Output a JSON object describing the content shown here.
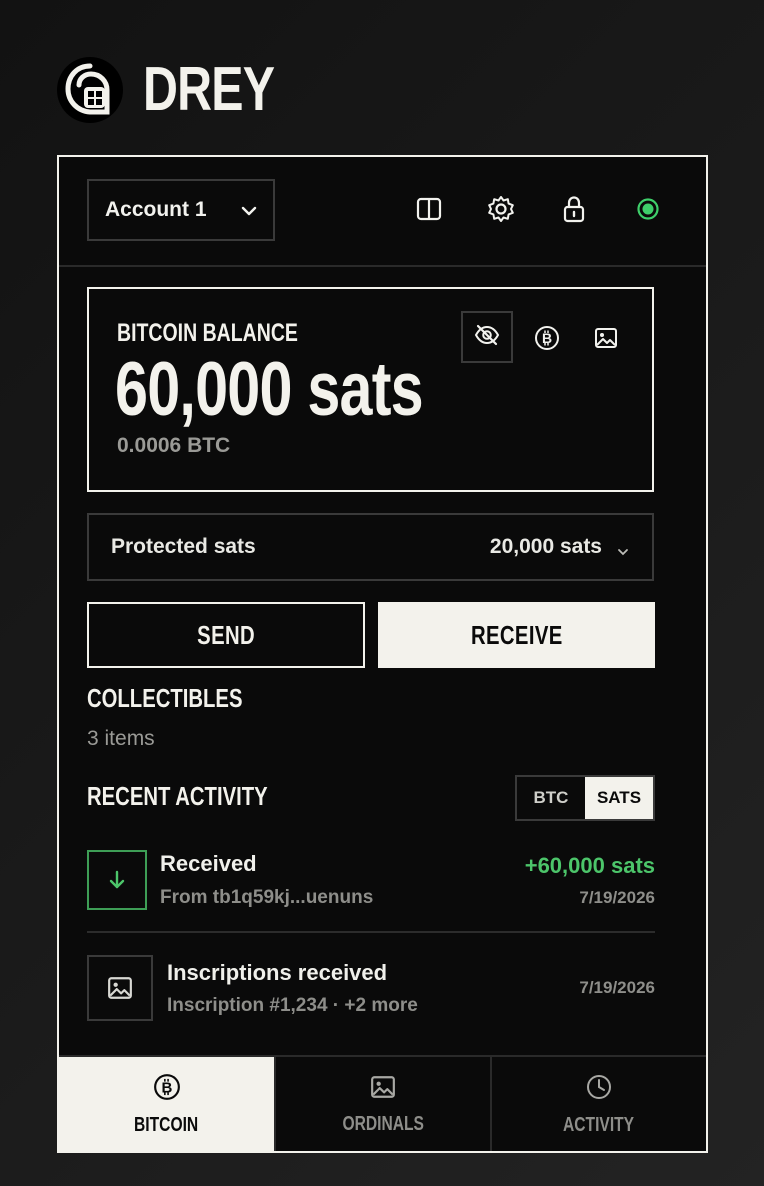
{
  "brand": {
    "name": "DREY",
    "logo_icon": "bird-logo-icon"
  },
  "header": {
    "account_label": "Account 1",
    "icons": [
      "sidebar-icon",
      "gear-icon",
      "lock-icon",
      "status-dot-icon"
    ],
    "status_color": "#3ecf6a"
  },
  "balance": {
    "label": "BITCOIN BALANCE",
    "amount": "60,000 sats",
    "btc": "0.0006 BTC",
    "icons": [
      "eye-off-icon",
      "bitcoin-icon",
      "image-icon"
    ]
  },
  "protected": {
    "label": "Protected sats",
    "value": "20,000 sats"
  },
  "actions": {
    "send": "SEND",
    "receive": "RECEIVE"
  },
  "collectibles": {
    "title": "COLLECTIBLES",
    "count": "3 items"
  },
  "recent_activity": {
    "title": "RECENT ACTIVITY",
    "toggle": {
      "btc": "BTC",
      "sats": "SATS",
      "selected": "SATS"
    },
    "items": [
      {
        "title": "Received",
        "subtitle": "From tb1q59kj...uenuns",
        "amount": "+60,000 sats",
        "date": "7/19/2026",
        "icon": "arrow-down-icon"
      },
      {
        "title": "Inscriptions received",
        "subtitle": "Inscription #1,234 · +2 more",
        "date": "7/19/2026",
        "icon": "image-icon"
      }
    ]
  },
  "nav": {
    "tabs": [
      {
        "label": "BITCOIN",
        "icon": "bitcoin-icon",
        "active": true
      },
      {
        "label": "ORDINALS",
        "icon": "image-icon",
        "active": false
      },
      {
        "label": "ACTIVITY",
        "icon": "clock-icon",
        "active": false
      }
    ]
  },
  "colors": {
    "accent_green": "#4cc56a",
    "cream": "#f3f2ec",
    "background": "#0a0a0a"
  }
}
